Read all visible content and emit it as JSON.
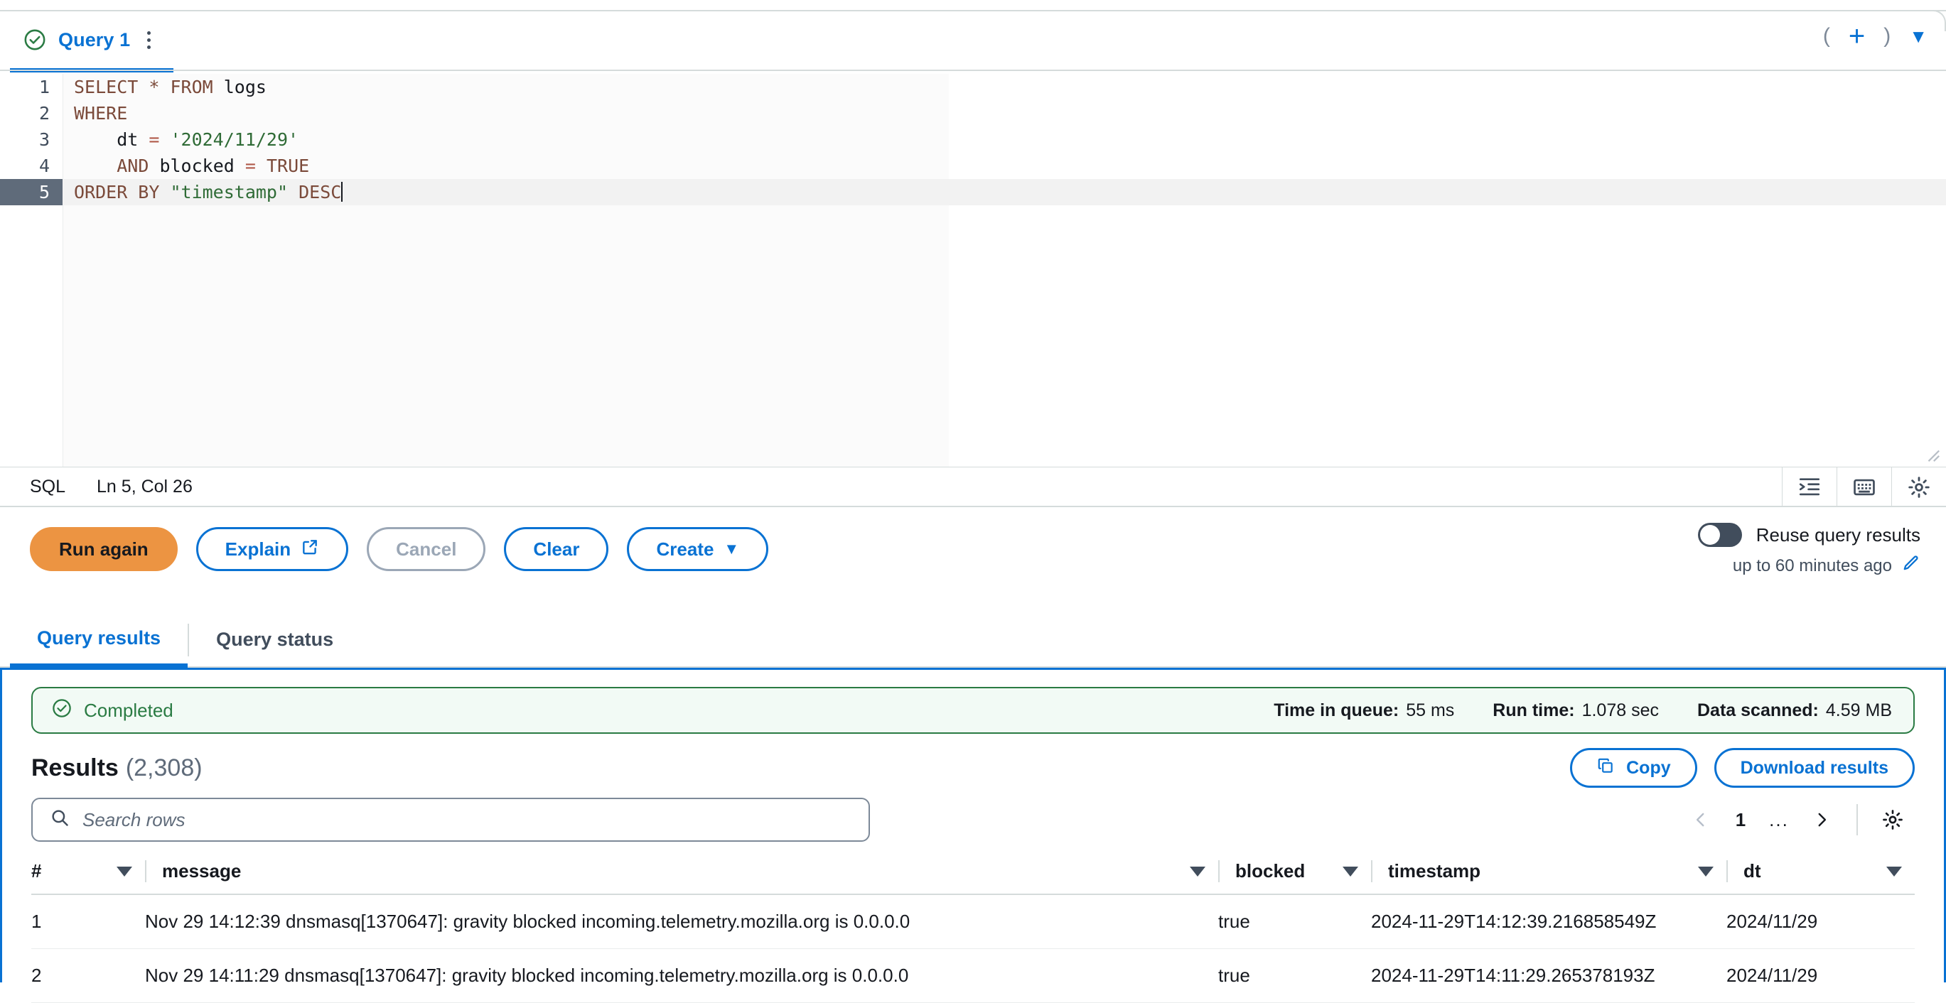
{
  "editor": {
    "tab": {
      "label": "Query 1",
      "status_icon": "check-circle-icon",
      "menu_icon": "kebab-menu-icon"
    },
    "tab_actions": {
      "left_paren": "(",
      "add": "+",
      "right_paren": ")",
      "caret": "▼"
    },
    "lines": [
      {
        "no": "1",
        "tokens": [
          {
            "t": "SELECT * FROM ",
            "c": "kw"
          },
          {
            "t": "logs",
            "c": "plain"
          }
        ]
      },
      {
        "no": "2",
        "tokens": [
          {
            "t": "WHERE",
            "c": "kw"
          }
        ]
      },
      {
        "no": "3",
        "tokens": [
          {
            "t": "    dt ",
            "c": "plain"
          },
          {
            "t": "= ",
            "c": "op"
          },
          {
            "t": "'2024/11/29'",
            "c": "str"
          }
        ]
      },
      {
        "no": "4",
        "tokens": [
          {
            "t": "    ",
            "c": "plain"
          },
          {
            "t": "AND ",
            "c": "kw"
          },
          {
            "t": "blocked ",
            "c": "plain"
          },
          {
            "t": "= ",
            "c": "op"
          },
          {
            "t": "TRUE",
            "c": "kw"
          }
        ]
      },
      {
        "no": "5",
        "tokens": [
          {
            "t": "ORDER BY ",
            "c": "kw"
          },
          {
            "t": "\"timestamp\"",
            "c": "str"
          },
          {
            "t": " DESC",
            "c": "kw"
          }
        ],
        "active": true,
        "cursor": true
      }
    ],
    "status": {
      "language": "SQL",
      "position": "Ln 5, Col 26",
      "icons": [
        "format-indent-icon",
        "keyboard-shortcuts-icon",
        "settings-gear-icon"
      ]
    }
  },
  "actions": {
    "run_again": "Run again",
    "explain": "Explain",
    "explain_icon": "external-link-icon",
    "cancel": "Cancel",
    "clear": "Clear",
    "create": "Create",
    "create_caret": "▼",
    "reuse_label": "Reuse query results",
    "reuse_enabled": false,
    "reuse_sub": "up to 60 minutes ago",
    "reuse_edit_icon": "pencil-edit-icon"
  },
  "result_tabs": [
    {
      "label": "Query results",
      "active": true
    },
    {
      "label": "Query status",
      "active": false
    }
  ],
  "status_banner": {
    "state": "Completed",
    "state_icon": "check-circle-icon",
    "metrics": [
      {
        "label": "Time in queue:",
        "value": "55 ms"
      },
      {
        "label": "Run time:",
        "value": "1.078 sec"
      },
      {
        "label": "Data scanned:",
        "value": "4.59 MB"
      }
    ]
  },
  "results": {
    "title": "Results",
    "count": "(2,308)",
    "copy_label": "Copy",
    "copy_icon": "copy-icon",
    "download_label": "Download results",
    "search_placeholder": "Search rows",
    "search_value": "",
    "search_icon": "search-icon",
    "pager": {
      "prev": "‹",
      "page": "1",
      "ellipsis": "...",
      "next": "›",
      "settings_icon": "settings-gear-icon"
    },
    "columns": [
      "#",
      "message",
      "blocked",
      "timestamp",
      "dt"
    ],
    "rows": [
      {
        "num": "1",
        "message": "Nov 29 14:12:39 dnsmasq[1370647]: gravity blocked incoming.telemetry.mozilla.org is 0.0.0.0",
        "blocked": "true",
        "timestamp": "2024-11-29T14:12:39.216858549Z",
        "dt": "2024/11/29"
      },
      {
        "num": "2",
        "message": "Nov 29 14:11:29 dnsmasq[1370647]: gravity blocked incoming.telemetry.mozilla.org is 0.0.0.0",
        "blocked": "true",
        "timestamp": "2024-11-29T14:11:29.265378193Z",
        "dt": "2024/11/29"
      }
    ]
  },
  "colors": {
    "accent_blue": "#0972d3",
    "primary_orange": "#ec9442",
    "success_green": "#2a7b43",
    "border_gray": "#d5dbdb"
  }
}
